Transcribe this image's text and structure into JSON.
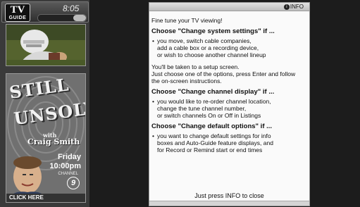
{
  "header": {
    "logo_line1": "TV",
    "logo_line2": "GUIDE",
    "clock": "8:05"
  },
  "ad": {
    "title_line1": "STILL",
    "title_line2": "UNSOLVED",
    "with": "with",
    "host": "Craig Smith",
    "day": "Friday",
    "time": "10:00pm",
    "channel_label": "CHANNEL",
    "channel_number": "9",
    "cta": "CLICK HERE"
  },
  "info": {
    "badge_label": "INFO",
    "intro": "Fine tune your TV viewing!",
    "sections": [
      {
        "heading": "Choose \"Change system settings\" if ...",
        "bullet": "you move, switch cable companies,\nadd a cable box or a recording device,\nor wish to choose another channel lineup",
        "after": "You'll be taken to a setup screen.\nJust choose one of the options, press Enter and follow\nthe on-screen instructions."
      },
      {
        "heading": "Choose \"Change channel display\" if ...",
        "bullet": "you would like to re-order channel location,\nchange the tune channel number,\nor switch channels On or Off in Listings"
      },
      {
        "heading": "Choose \"Change default options\" if ...",
        "bullet": "you want to change default settings for info\nboxes and Auto-Guide feature displays, and\nfor Record or Remind start or end times"
      }
    ],
    "close_note": "Just press INFO to close"
  }
}
